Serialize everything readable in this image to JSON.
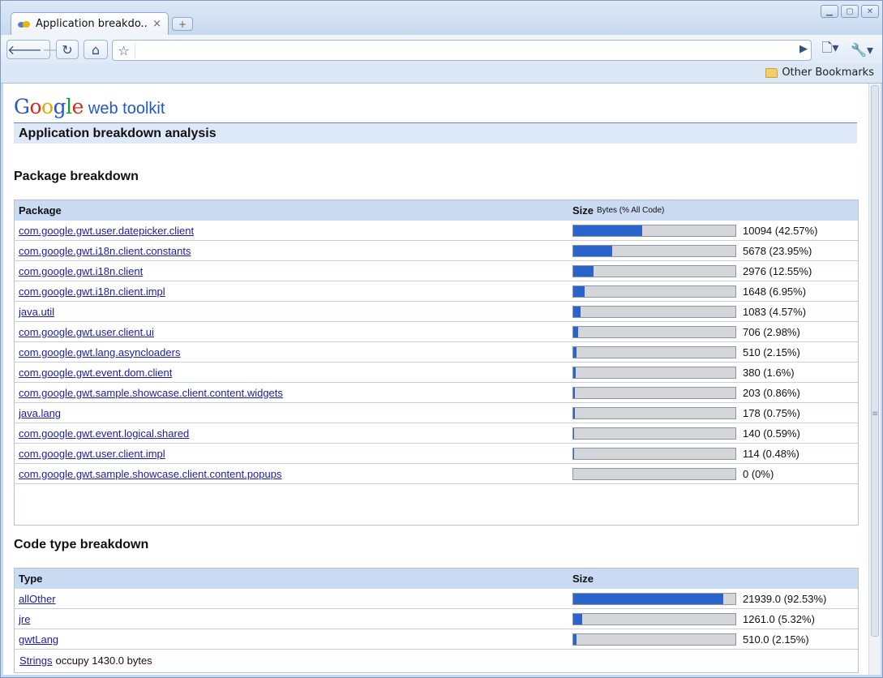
{
  "browser": {
    "tab_title": "Application breakdo...",
    "tab_close": "×",
    "new_tab_icon": "+",
    "bookmarks_other": "Other Bookmarks"
  },
  "page": {
    "logo_word": [
      "G",
      "o",
      "o",
      "g",
      "l",
      "e"
    ],
    "logo_suffix": "web toolkit",
    "header": "Application breakdown analysis",
    "package_section": {
      "title": "Package breakdown",
      "col_package": "Package",
      "col_size": "Size",
      "col_size_sub": "Bytes (% All Code)",
      "rows": [
        {
          "name": "com.google.gwt.user.datepicker.client",
          "size": "10094 (42.57%)",
          "pct": 42.57
        },
        {
          "name": "com.google.gwt.i18n.client.constants",
          "size": "5678 (23.95%)",
          "pct": 23.95
        },
        {
          "name": "com.google.gwt.i18n.client",
          "size": "2976 (12.55%)",
          "pct": 12.55
        },
        {
          "name": "com.google.gwt.i18n.client.impl",
          "size": "1648 (6.95%)",
          "pct": 6.95
        },
        {
          "name": "java.util",
          "size": "1083 (4.57%)",
          "pct": 4.57
        },
        {
          "name": "com.google.gwt.user.client.ui",
          "size": "706 (2.98%)",
          "pct": 2.98
        },
        {
          "name": "com.google.gwt.lang.asyncloaders",
          "size": "510 (2.15%)",
          "pct": 2.15
        },
        {
          "name": "com.google.gwt.event.dom.client",
          "size": "380 (1.6%)",
          "pct": 1.6
        },
        {
          "name": "com.google.gwt.sample.showcase.client.content.widgets",
          "size": "203 (0.86%)",
          "pct": 0.86
        },
        {
          "name": "java.lang",
          "size": "178 (0.75%)",
          "pct": 0.75
        },
        {
          "name": "com.google.gwt.event.logical.shared",
          "size": "140 (0.59%)",
          "pct": 0.59
        },
        {
          "name": "com.google.gwt.user.client.impl",
          "size": "114 (0.48%)",
          "pct": 0.48
        },
        {
          "name": "com.google.gwt.sample.showcase.client.content.popups",
          "size": "0 (0%)",
          "pct": 0
        }
      ]
    },
    "codetype_section": {
      "title": "Code type breakdown",
      "col_type": "Type",
      "col_size": "Size",
      "rows": [
        {
          "name": "allOther",
          "size": "21939.0 (92.53%)",
          "pct": 92.53
        },
        {
          "name": "jre",
          "size": "1261.0 (5.32%)",
          "pct": 5.32
        },
        {
          "name": "gwtLang",
          "size": "510.0 (2.15%)",
          "pct": 2.15
        }
      ],
      "strings_link": "Strings",
      "strings_text": "occupy 1430.0 bytes"
    }
  },
  "colors": {
    "bar_fill": "#2a63cc",
    "bar_track": "#d4d6d9",
    "table_header": "#c9daf2",
    "link": "#1c1ca8"
  }
}
